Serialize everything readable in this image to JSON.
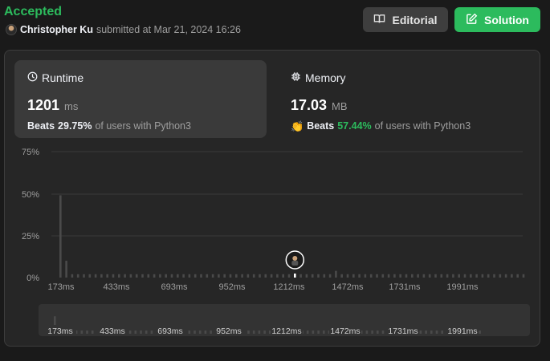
{
  "header": {
    "status": "Accepted",
    "user": "Christopher Ku",
    "submitted_text": "submitted at Mar 21, 2024 16:26",
    "editorial_label": "Editorial",
    "solution_label": "Solution"
  },
  "runtime": {
    "title": "Runtime",
    "value": "1201",
    "unit": "ms",
    "beats_label": "Beats",
    "beats_pct": "29.75%",
    "beats_suffix": "of users with Python3"
  },
  "memory": {
    "title": "Memory",
    "value": "17.03",
    "unit": "MB",
    "beats_label": "Beats",
    "beats_pct": "57.44%",
    "beats_suffix": "of users with Python3"
  },
  "colors": {
    "accent_green": "#2cbb5d",
    "bar": "#4a4a4a",
    "grid": "#3a3a3a"
  },
  "chart_data": {
    "type": "bar",
    "y_ticks": [
      "75%",
      "50%",
      "25%",
      "0%"
    ],
    "ylim": [
      0,
      75
    ],
    "x_tick_labels": [
      "173ms",
      "433ms",
      "693ms",
      "952ms",
      "1212ms",
      "1472ms",
      "1731ms",
      "1991ms"
    ],
    "x_range_ms": [
      173,
      2251
    ],
    "bin_width_ms": 26,
    "values": [
      49,
      10,
      2,
      2,
      2,
      2,
      2,
      2,
      2,
      2,
      2,
      2,
      2,
      2,
      2,
      2,
      2,
      2,
      2,
      2,
      2,
      2,
      2,
      2,
      2,
      2,
      2,
      2,
      2,
      2,
      2,
      2,
      2,
      2,
      2,
      2,
      2,
      2,
      2,
      2,
      2,
      2,
      2,
      2,
      2,
      2,
      2,
      4,
      2,
      2,
      2,
      2,
      2,
      2,
      2,
      2,
      2,
      2,
      2,
      2,
      2,
      2,
      2,
      2,
      2,
      2,
      2,
      2,
      2,
      2,
      2,
      2,
      2,
      2,
      2,
      2,
      2,
      2,
      2,
      2
    ],
    "user_marker_ms": 1212,
    "highlight_color": "#ffffff"
  }
}
